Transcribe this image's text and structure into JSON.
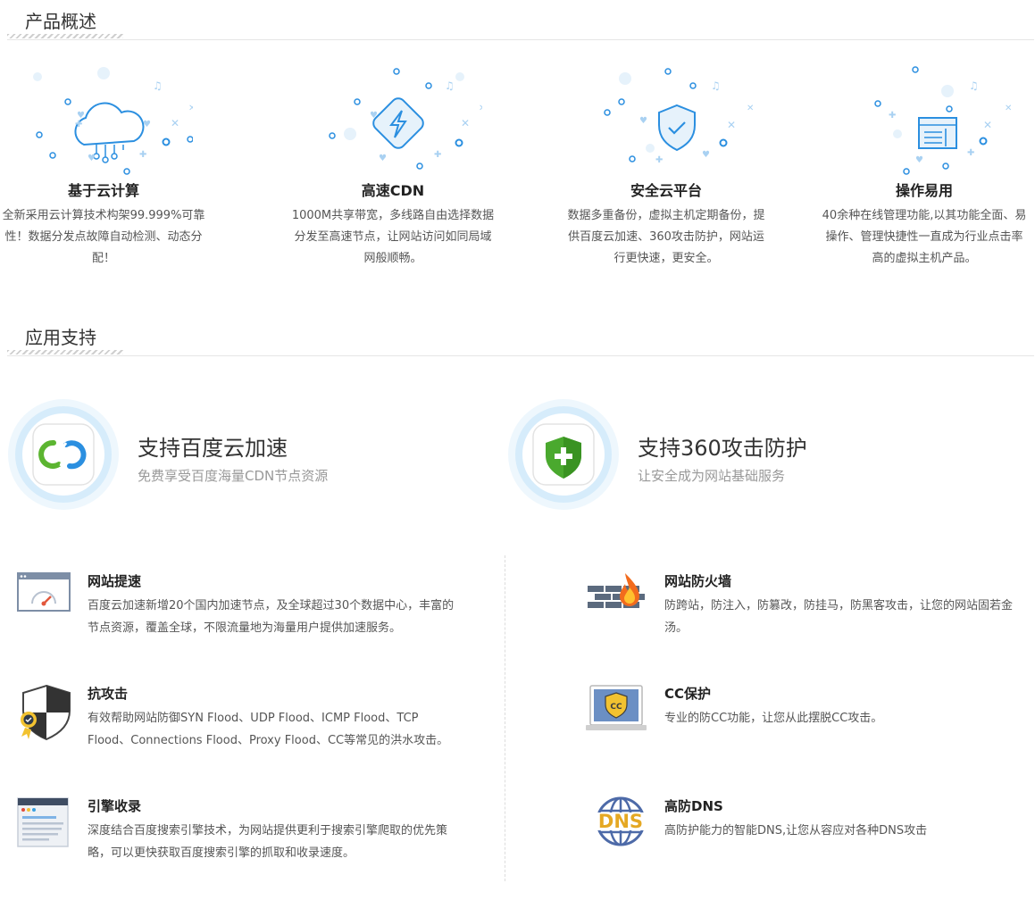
{
  "overview": {
    "title": "产品概述",
    "features": [
      {
        "icon": "cloud-computing-icon",
        "title": "基于云计算",
        "desc": "全新采用云计算技术构架99.999%可靠性！数据分发点故障自动检测、动态分配！"
      },
      {
        "icon": "cdn-lightning-icon",
        "title": "高速CDN",
        "desc": "1000M共享带宽，多线路自由选择数据分发至高速节点，让网站访问如同局域网般顺畅。"
      },
      {
        "icon": "security-shield-icon",
        "title": "安全云平台",
        "desc": "数据多重备份，虚拟主机定期备份，提供百度云加速、360攻击防护，网站运行更快速，更安全。"
      },
      {
        "icon": "browser-window-icon",
        "title": "操作易用",
        "desc": "40余种在线管理功能,以其功能全面、易操作、管理快捷性一直成为行业点击率高的虚拟主机产品。"
      }
    ]
  },
  "apps": {
    "title": "应用支持",
    "supports": [
      {
        "icon": "baidu-cloud-icon",
        "title": "支持百度云加速",
        "subtitle": "免费享受百度海量CDN节点资源"
      },
      {
        "icon": "shield-plus-icon",
        "title": "支持360攻击防护",
        "subtitle": "让安全成为网站基础服务"
      }
    ],
    "items": [
      {
        "icon": "speedometer-icon",
        "title": "网站提速",
        "desc": "百度云加速新增20个国内加速节点，及全球超过30个数据中心，丰富的节点资源，覆盖全球，不限流量地为海量用户提供加速服务。"
      },
      {
        "icon": "firewall-icon",
        "title": "网站防火墙",
        "desc": "防跨站，防注入，防篡改，防挂马，防黑客攻击，让您的网站固若金汤。"
      },
      {
        "icon": "anti-attack-shield-icon",
        "title": "抗攻击",
        "desc": "有效帮助网站防御SYN Flood、UDP Flood、ICMP Flood、TCP Flood、Connections Flood、Proxy Flood、CC等常见的洪水攻击。"
      },
      {
        "icon": "cc-protection-icon",
        "title": "CC保护",
        "desc": "专业的防CC功能，让您从此摆脱CC攻击。"
      },
      {
        "icon": "search-engine-icon",
        "title": "引擎收录",
        "desc": "深度结合百度搜索引擎技术，为网站提供更利于搜索引擎爬取的优先策略，可以更快获取百度搜索引擎的抓取和收录速度。"
      },
      {
        "icon": "dns-globe-icon",
        "title": "高防DNS",
        "desc": "高防护能力的智能DNS,让您从容应对各种DNS攻击",
        "icon_label": "DNS",
        "icon_badge": "CC"
      }
    ]
  },
  "colors": {
    "accent": "#2b8fe0",
    "light_blue": "#d9eefb",
    "green": "#5cb531",
    "fire": "#f26b1d",
    "dns_gold": "#e5a823",
    "dns_blue": "#4d6aa8"
  }
}
